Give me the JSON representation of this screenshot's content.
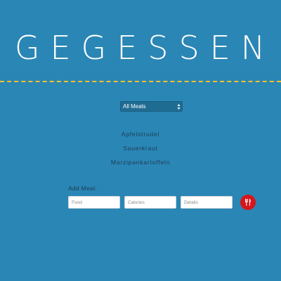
{
  "header": {
    "logo": "GEGESSEN"
  },
  "filter": {
    "selected": "All Meals"
  },
  "meals": [
    "Apfelstrudel",
    "Sauerkraut",
    "Marzipankartoffeln"
  ],
  "add_meal": {
    "label": "Add Meal:",
    "food_placeholder": "Food",
    "calories_placeholder": "Calories",
    "details_placeholder": "Details",
    "button_icon": "utensils-icon"
  },
  "colors": {
    "background": "#2a86b5",
    "divider": "#f2c230",
    "add_button": "#d6161a"
  }
}
